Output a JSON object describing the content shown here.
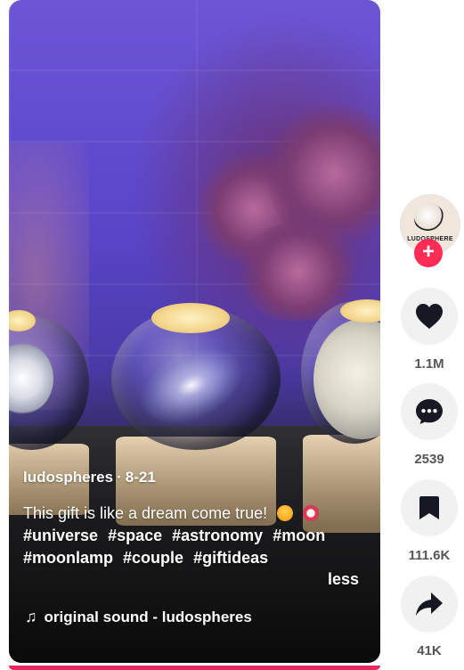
{
  "post": {
    "author": "ludospheres",
    "date": "8-21",
    "caption_text": "This gift is like a dream come true!",
    "hashtags": [
      "#universe",
      "#space",
      "#astronomy",
      "#moon",
      "#moonlamp",
      "#couple",
      "#giftideas"
    ],
    "less_label": "less",
    "sound": "original sound - ludospheres",
    "separator": "·"
  },
  "creator": {
    "avatar_text": "LUDOSPHERE",
    "follow_label": "+"
  },
  "actions": {
    "likes": "1.1M",
    "comments": "2539",
    "saves": "111.6K",
    "shares": "41K"
  },
  "icons": {
    "like": "heart-icon",
    "comment": "comment-dots-icon",
    "save": "bookmark-icon",
    "share": "share-arrow-icon",
    "sound": "music-note-icon"
  },
  "colors": {
    "accent": "#fe2c55",
    "progress": "#e8285e",
    "action_bg": "#f1f1f2",
    "count_text": "#555555"
  }
}
